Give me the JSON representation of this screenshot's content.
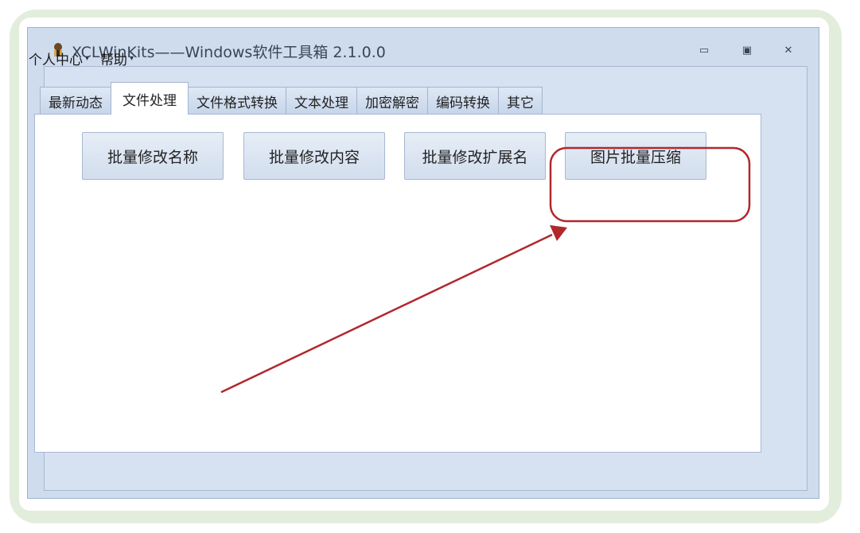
{
  "window": {
    "title": "XCLWinKits——Windows软件工具箱 2.1.0.0",
    "controls": {
      "minimize": "▭",
      "maximize": "▣",
      "close": "✕"
    }
  },
  "menu": [
    {
      "label": "个人中心",
      "caret": "▾"
    },
    {
      "label": "帮助",
      "caret": "▾"
    }
  ],
  "tabs": [
    {
      "label": "最新动态"
    },
    {
      "label": "文件处理"
    },
    {
      "label": "文件格式转换"
    },
    {
      "label": "文本处理"
    },
    {
      "label": "加密解密"
    },
    {
      "label": "编码转换"
    },
    {
      "label": "其它"
    }
  ],
  "active_tab": "文件处理",
  "buttons": [
    {
      "label": "批量修改名称"
    },
    {
      "label": "批量修改内容"
    },
    {
      "label": "批量修改扩展名"
    },
    {
      "label": "图片批量压缩"
    }
  ],
  "colors": {
    "annotation": "#b0282c",
    "frame": "#e3eddc",
    "window_bg": "#cfdcee"
  },
  "icons": {
    "app": "app-icon",
    "minimize": "minimize-icon",
    "maximize": "maximize-icon",
    "close": "close-icon"
  }
}
